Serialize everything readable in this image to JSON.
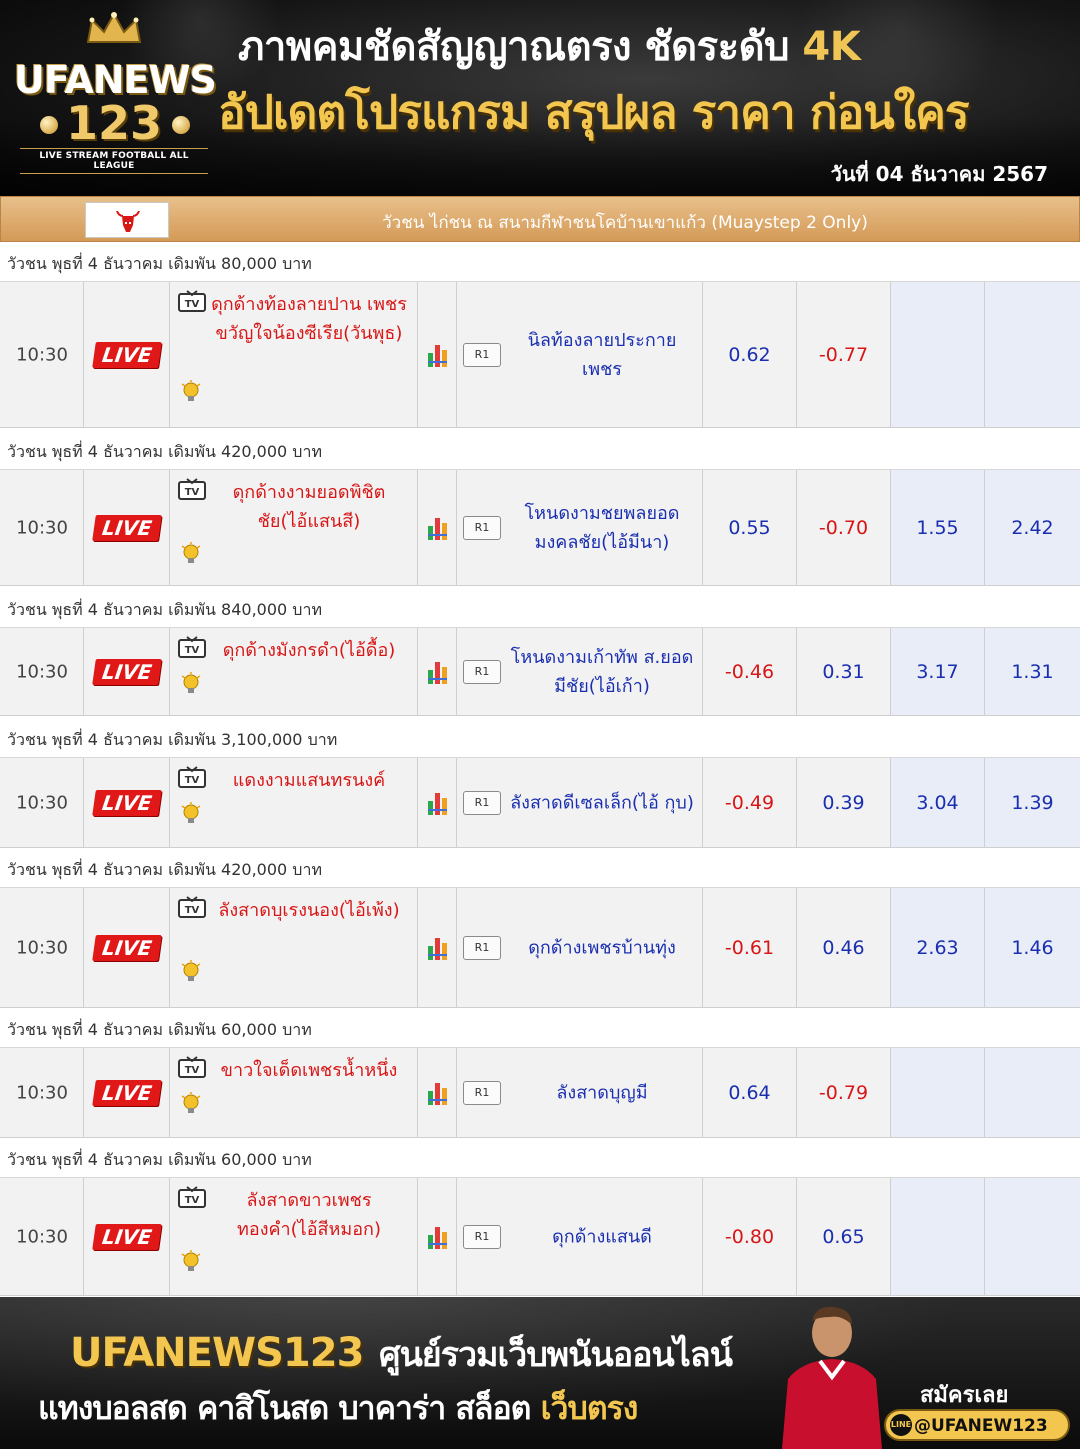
{
  "header": {
    "logo_brand": "UFANEWS",
    "logo_number": "123",
    "logo_tagline": "LIVE STREAM FOOTBALL ALL LEAGUE",
    "title_line1": "ภาพคมชัดสัญญาณตรง ชัดระดับ",
    "title_line1_highlight": "4K",
    "title_line2": "อัปเดตโปรแกรม สรุปผล ราคา ก่อนใคร",
    "date": "วันที่ 04 ธันวาคม 2567"
  },
  "league": {
    "name": "วัวชน ไก่ชน ณ สนามกีฬาชนโคบ้านเขาแก้ว (Muaystep 2 Only)",
    "flag_icon": "bull-icon"
  },
  "matches": [
    {
      "header": "วัวชน พุธที่ 4 ธันวาคม เดิมพัน 80,000 บาท",
      "time": "10:30",
      "live": "LIVE",
      "home": "ดุกด้างท้องลายปาน เพชรขวัญใจน้องซีเรีย(วันพุธ)",
      "round": "R1",
      "away": "นิลท้องลายประกาย เพชร",
      "odds": [
        "0.62",
        "-0.77",
        "",
        ""
      ]
    },
    {
      "header": "วัวชน พุธที่ 4 ธันวาคม เดิมพัน 420,000 บาท",
      "time": "10:30",
      "live": "LIVE",
      "home": "ดุกด้างงามยอดพิชิตชัย(ไอ้แสนสี)",
      "round": "R1",
      "away": "โหนดงามชยพลยอด มงคลชัย(ไอ้มีนา)",
      "odds": [
        "0.55",
        "-0.70",
        "1.55",
        "2.42"
      ]
    },
    {
      "header": "วัวชน พุธที่ 4 ธันวาคม เดิมพัน 840,000 บาท",
      "time": "10:30",
      "live": "LIVE",
      "home": "ดุกด้างมังกรดำ(ไอ้ดื้อ)",
      "round": "R1",
      "away": "โหนดงามเก้าทัพ ส.ยอดมีชัย(ไอ้เก้า)",
      "odds": [
        "-0.46",
        "0.31",
        "3.17",
        "1.31"
      ]
    },
    {
      "header": "วัวชน พุธที่ 4 ธันวาคม เดิมพัน 3,100,000 บาท",
      "time": "10:30",
      "live": "LIVE",
      "home": "แดงงามแสนทรนงค์",
      "round": "R1",
      "away": "ลังสาดดีเซลเล็ก(ไอ้ กุบ)",
      "odds": [
        "-0.49",
        "0.39",
        "3.04",
        "1.39"
      ]
    },
    {
      "header": "วัวชน พุธที่ 4 ธันวาคม เดิมพัน 420,000 บาท",
      "time": "10:30",
      "live": "LIVE",
      "home": "ลังสาดบุเรงนอง(ไอ้เพ้ง)",
      "round": "R1",
      "away": "ดุกด้างเพชรบ้านทุ่ง",
      "odds": [
        "-0.61",
        "0.46",
        "2.63",
        "1.46"
      ]
    },
    {
      "header": "วัวชน พุธที่ 4 ธันวาคม เดิมพัน 60,000 บาท",
      "time": "10:30",
      "live": "LIVE",
      "home": "ขาวใจเด็ดเพชรน้ำหนึ่ง",
      "round": "R1",
      "away": "ลังสาดบุญมี",
      "odds": [
        "0.64",
        "-0.79",
        "",
        ""
      ]
    },
    {
      "header": "วัวชน พุธที่ 4 ธันวาคม เดิมพัน 60,000 บาท",
      "time": "10:30",
      "live": "LIVE",
      "home": "ลังสาดขาวเพชร ทองคำ(ไอ้สีหมอก)",
      "round": "R1",
      "away": "ดุกด้างแสนดี",
      "odds": [
        "-0.80",
        "0.65",
        "",
        ""
      ]
    }
  ],
  "footer": {
    "brand": "UFANEWS123",
    "slogan": "ศูนย์รวมเว็บพนันออนไลน์",
    "services": "แทงบอลสด คาสิโนสด บาคาร่า สล็อต",
    "services_highlight": "เว็บตรง",
    "signup": "สมัครเลย",
    "line_label": "LINE",
    "line_handle": "@UFANEW123"
  },
  "colors": {
    "home_team": "#d81616",
    "away_team": "#1a2fb0",
    "odd_positive": "#1a2fb0",
    "odd_negative": "#d81616",
    "live_badge": "#e01818",
    "league_bar": "#d49a57",
    "gold": "#f3c74f"
  }
}
